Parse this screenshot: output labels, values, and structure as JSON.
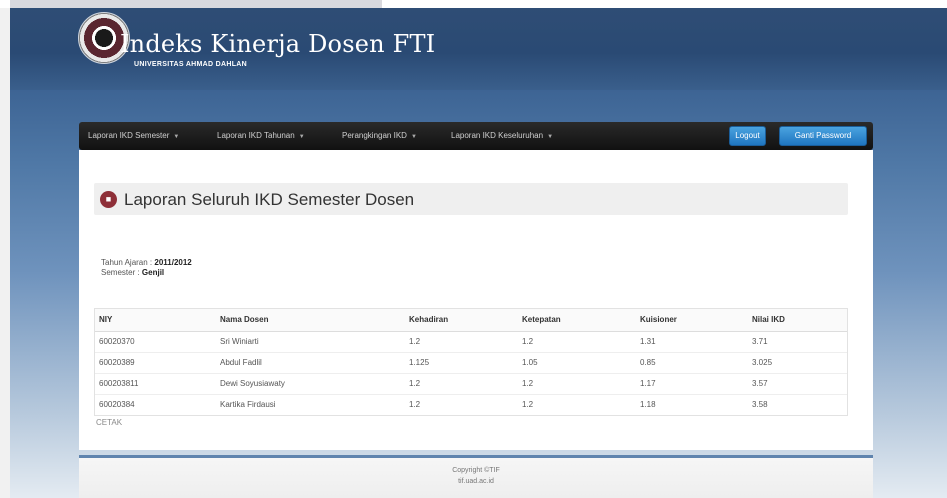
{
  "header": {
    "title": "Indeks Kinerja Dosen FTI",
    "subtitle": "UNIVERSITAS AHMAD DAHLAN"
  },
  "navbar": {
    "menu": [
      {
        "label": "Laporan IKD Semester"
      },
      {
        "label": "Laporan IKD Tahunan"
      },
      {
        "label": "Perangkingan IKD"
      },
      {
        "label": "Laporan IKD Keseluruhan"
      }
    ],
    "logout_label": "Logout",
    "change_password_label": "Ganti Password"
  },
  "page": {
    "title": "Laporan Seluruh IKD Semester Dosen",
    "academic_year_label": "Tahun Ajaran : ",
    "academic_year": "2011/2012",
    "semester_label": "Semester : ",
    "semester": "Genjil"
  },
  "table": {
    "headers": [
      "NIY",
      "Nama Dosen",
      "Kehadiran",
      "Ketepatan",
      "Kuisioner",
      "Nilai IKD"
    ],
    "rows": [
      [
        "60020370",
        "Sri Winiarti",
        "1.2",
        "1.2",
        "1.31",
        "3.71"
      ],
      [
        "60020389",
        "Abdul Fadlil",
        "1.125",
        "1.05",
        "0.85",
        "3.025"
      ],
      [
        "600203811",
        "Dewi Soyusiawaty",
        "1.2",
        "1.2",
        "1.17",
        "3.57"
      ],
      [
        "60020384",
        "Kartika Firdausi",
        "1.2",
        "1.2",
        "1.18",
        "3.58"
      ]
    ]
  },
  "print_label": "CETAK",
  "footer": {
    "copyright": "Copyright ©TIF",
    "domain": "tif.uad.ac.id"
  },
  "colors": {
    "header_bg": "#2a4a74",
    "navbar_bg": "#1a1a1a",
    "button_blue": "#2f86cf",
    "title_icon": "#8e2f38"
  }
}
